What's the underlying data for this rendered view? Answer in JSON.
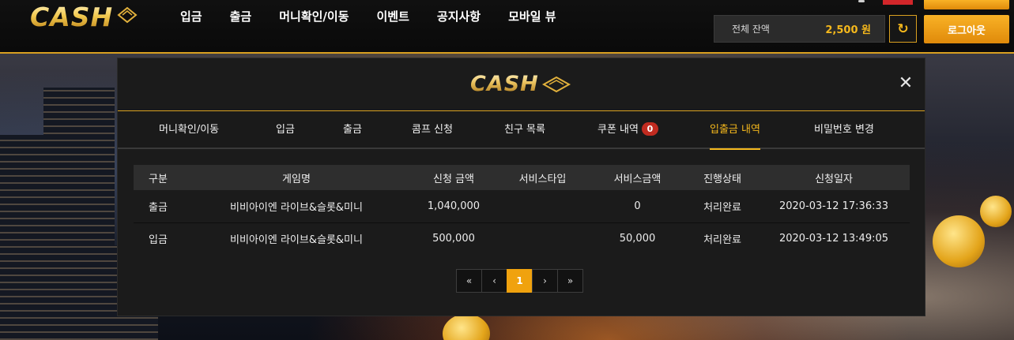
{
  "brand": {
    "logo_text": "CASH"
  },
  "nav": {
    "items": [
      {
        "label": "입금"
      },
      {
        "label": "출금"
      },
      {
        "label": "머니확인/이동"
      },
      {
        "label": "이벤트"
      },
      {
        "label": "공지사항"
      },
      {
        "label": "모바일 뷰"
      }
    ]
  },
  "account": {
    "balance_label": "전체 잔액",
    "balance_value": "2,500 원",
    "refresh_icon": "refresh-icon",
    "logout_label": "로그아웃"
  },
  "modal": {
    "logo_text": "CASH",
    "close_icon": "close-icon",
    "tabs": [
      {
        "label": "머니확인/이동"
      },
      {
        "label": "입금"
      },
      {
        "label": "출금"
      },
      {
        "label": "콤프 신청"
      },
      {
        "label": "친구 목록"
      },
      {
        "label": "쿠폰 내역",
        "badge": "0"
      },
      {
        "label": "입출금 내역",
        "active": true
      },
      {
        "label": "비밀번호 변경"
      }
    ],
    "table": {
      "columns": [
        "구분",
        "게임명",
        "신청 금액",
        "서비스타입",
        "서비스금액",
        "진행상태",
        "신청일자"
      ],
      "rows": [
        [
          "출금",
          "비비아이엔 라이브&슬롯&미니",
          "1,040,000",
          "",
          "0",
          "처리완료",
          "2020-03-12 17:36:33"
        ],
        [
          "입금",
          "비비아이엔 라이브&슬롯&미니",
          "500,000",
          "",
          "50,000",
          "처리완료",
          "2020-03-12 13:49:05"
        ]
      ]
    },
    "pagination": {
      "first": "«",
      "prev": "‹",
      "current": "1",
      "next": "›",
      "last": "»"
    }
  },
  "colors": {
    "accent": "#f5b81c",
    "button": "#f0a20e",
    "badge": "#c12b20"
  }
}
